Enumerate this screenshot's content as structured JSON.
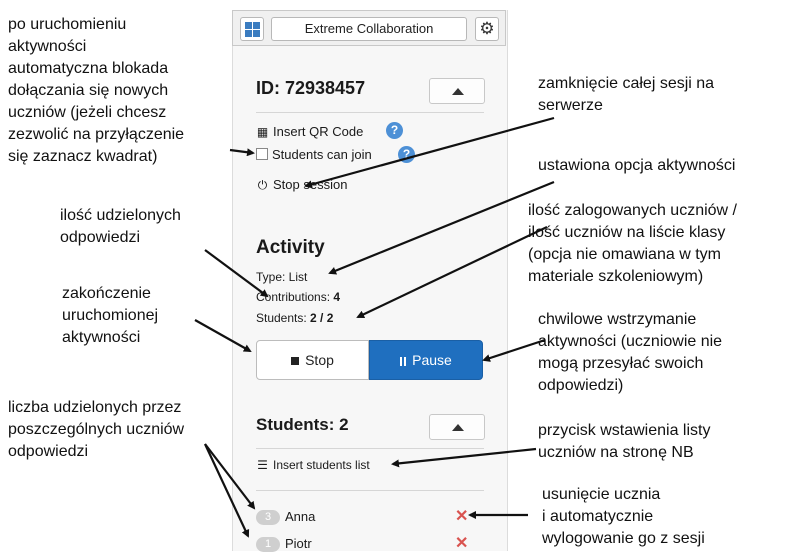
{
  "toolbar": {
    "title": "Extreme Collaboration"
  },
  "session": {
    "id_label": "ID: 72938457",
    "insert_qr": "Insert QR Code",
    "students_can_join": "Students can join",
    "stop_session": "Stop session"
  },
  "activity": {
    "heading": "Activity",
    "type": "Type: List",
    "contributions_label": "Contributions:",
    "contributions_value": "4",
    "students_label": "Students:",
    "students_value": "2 / 2",
    "stop_label": "Stop",
    "pause_label": "Pause"
  },
  "students": {
    "heading": "Students: 2",
    "insert_list": "Insert students list",
    "items": [
      {
        "count": "3",
        "name": "Anna"
      },
      {
        "count": "1",
        "name": "Piotr"
      }
    ]
  },
  "annotations": {
    "left1": [
      "po uruchomieniu",
      "aktywności",
      "automatyczna blokada",
      "dołączania się nowych",
      "uczniów (jeżeli chcesz",
      "zezwolić na przyłączenie",
      "się zaznacz kwadrat)"
    ],
    "left2": [
      "ilość udzielonych",
      "odpowiedzi"
    ],
    "left3": [
      "zakończenie",
      "uruchomionej",
      "aktywności"
    ],
    "left4": [
      "liczba udzielonych przez",
      "poszczególnych uczniów",
      "odpowiedzi"
    ],
    "right1": [
      "zamknięcie całej sesji na",
      "serwerze"
    ],
    "right2": [
      "ustawiona opcja aktywności"
    ],
    "right3": [
      "ilość zalogowanych uczniów /",
      "ilość uczniów na liście klasy",
      "(opcja nie omawiana w tym",
      "materiale szkoleniowym)"
    ],
    "right4": [
      "chwilowe wstrzymanie",
      "aktywności (uczniowie nie",
      "mogą przesyłać swoich",
      "odpowiedzi)"
    ],
    "right5": [
      "przycisk wstawienia listy",
      "uczniów na stronę NB"
    ],
    "right6": [
      "usunięcie ucznia",
      "i automatycznie",
      "wylogowanie go z sesji"
    ]
  },
  "colors": {
    "accent": "#1f6fbf",
    "help": "#4d90d6",
    "delete": "#d9534f"
  }
}
